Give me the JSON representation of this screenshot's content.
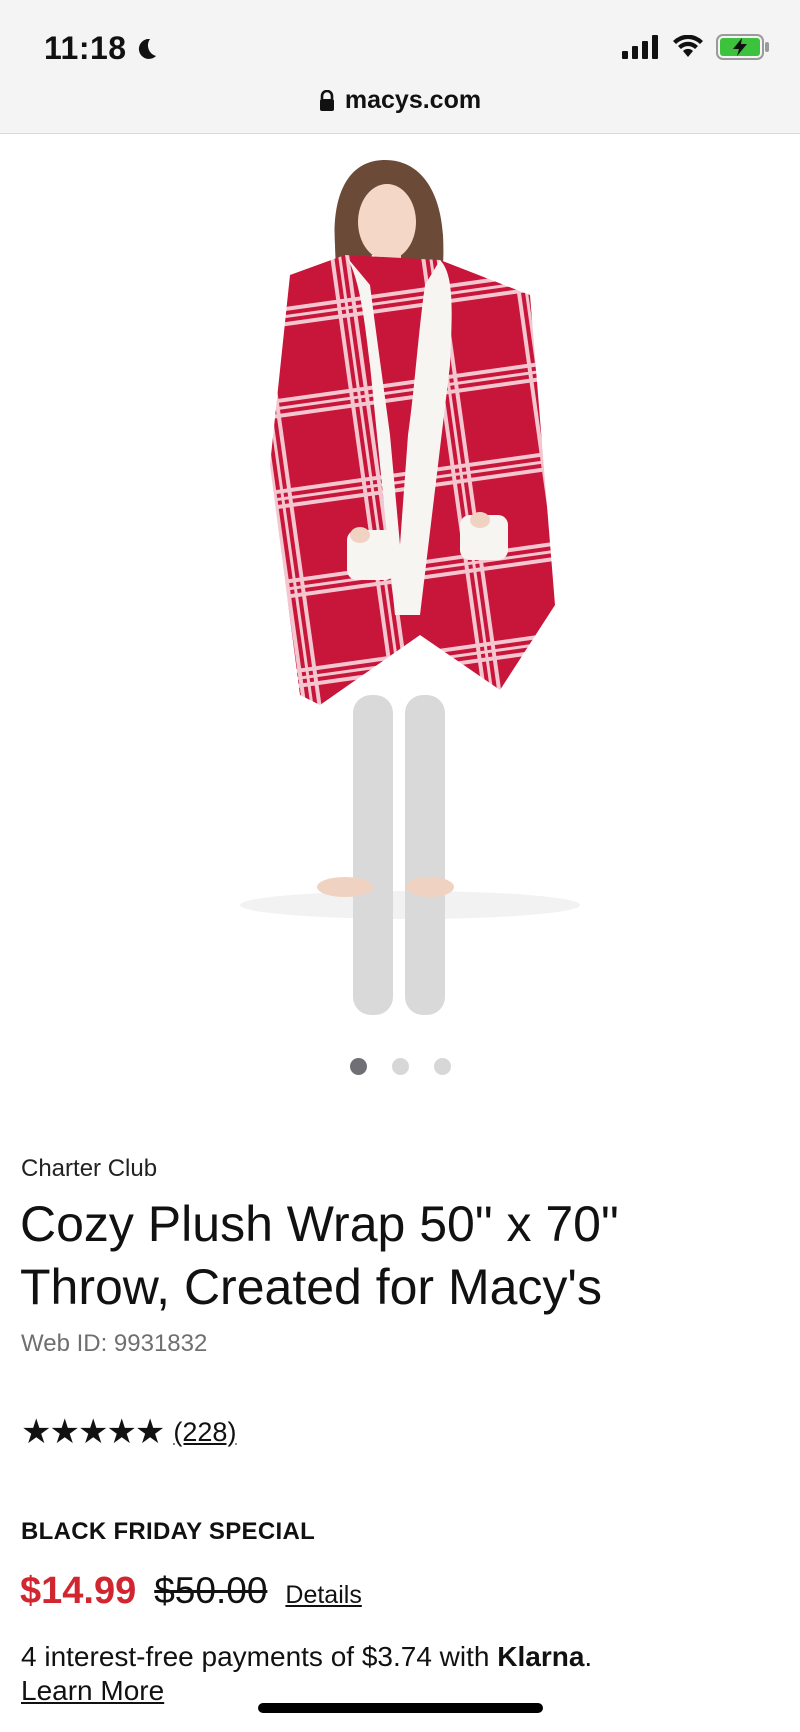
{
  "status_bar": {
    "time": "11:18",
    "icons": [
      "moon-icon",
      "signal-icon",
      "wifi-icon",
      "battery-charging-icon"
    ]
  },
  "browser": {
    "url": "macys.com",
    "lock_icon": "lock-icon"
  },
  "gallery": {
    "total_images": 3,
    "active_index": 0
  },
  "product": {
    "brand": "Charter Club",
    "title_line1": "Cozy Plush Wrap 50\" x 70\"",
    "title_line2": "Throw, Created for Macy's",
    "web_id": "Web ID: 9931832",
    "rating_stars": "★★★★★",
    "rating_value": 5,
    "review_count": "(228)",
    "promo_label": "BLACK FRIDAY SPECIAL",
    "sale_price": "$14.99",
    "original_price": "$50.00",
    "details_label": "Details",
    "klarna_text": "4 interest-free payments of $3.74 with ",
    "klarna_brand": "Klarna",
    "klarna_period": ".",
    "learn_more": "Learn More"
  },
  "colors": {
    "sale_price": "#d12630",
    "wrap_red": "#c8153a",
    "dot_active": "#6f6f75",
    "dot_inactive": "#d7d7d7"
  }
}
